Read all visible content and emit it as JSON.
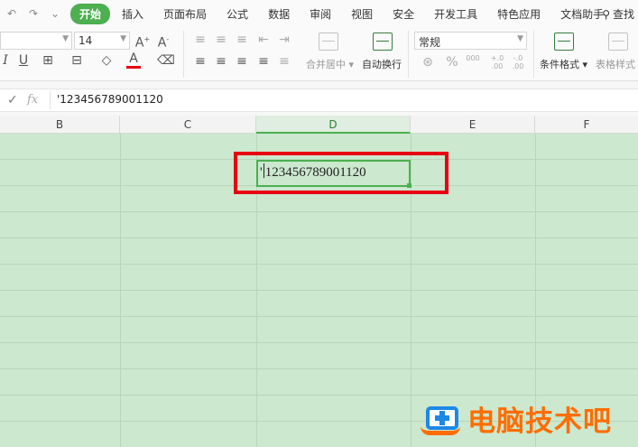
{
  "menu": {
    "tabs": [
      "开始",
      "插入",
      "页面布局",
      "公式",
      "数据",
      "审阅",
      "视图",
      "安全",
      "开发工具",
      "特色应用",
      "文档助手"
    ],
    "search_label": "查找"
  },
  "ribbon": {
    "font_name": "",
    "font_size": "14",
    "merge_label": "合并居中",
    "wrap_label": "自动换行",
    "number_format": "常规",
    "number_icons": [
      "%",
      "000",
      "+.0 .00",
      "-.0 .00"
    ],
    "conditional_label": "条件格式",
    "table_style_label": "表格样式"
  },
  "formula_bar": {
    "fx_label": "fx",
    "content": "'123456789001120"
  },
  "columns": [
    "B",
    "C",
    "D",
    "E",
    "F"
  ],
  "active_cell": {
    "column": "D",
    "prefix": "'",
    "value": "123456789001120"
  },
  "watermark": {
    "text": "电脑技术吧"
  },
  "colors": {
    "accent": "#4caf50",
    "grid_bg": "#cce8cf",
    "highlight": "#e60012",
    "watermark": "#ff6d00",
    "watermark_icon": "#1e88e5"
  }
}
